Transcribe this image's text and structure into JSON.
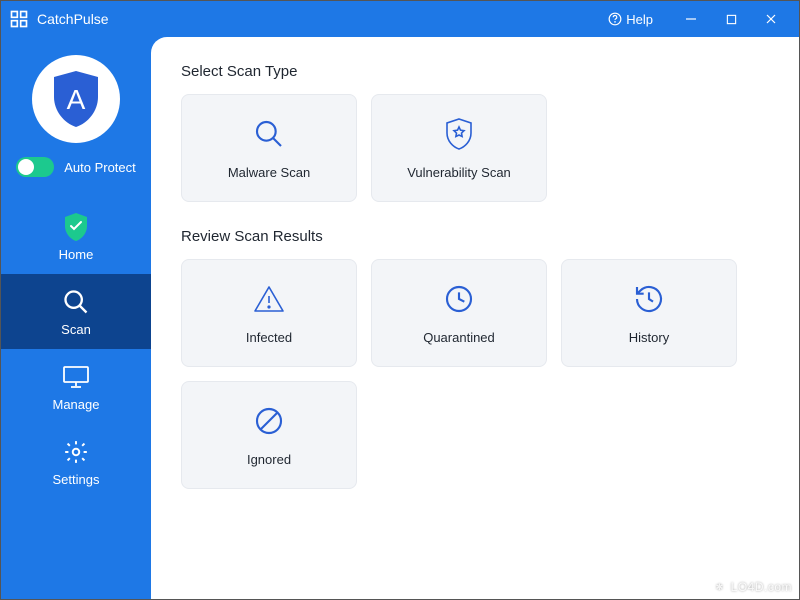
{
  "app": {
    "title": "CatchPulse",
    "help_label": "Help"
  },
  "sidebar": {
    "auto_protect_label": "Auto Protect",
    "auto_protect_on": true,
    "nav": [
      {
        "label": "Home",
        "icon": "shield-check-icon",
        "active": false
      },
      {
        "label": "Scan",
        "icon": "search-icon",
        "active": true
      },
      {
        "label": "Manage",
        "icon": "monitor-icon",
        "active": false
      },
      {
        "label": "Settings",
        "icon": "gear-icon",
        "active": false
      }
    ]
  },
  "content": {
    "section1_title": "Select Scan Type",
    "scan_types": [
      {
        "label": "Malware Scan",
        "icon": "search-icon"
      },
      {
        "label": "Vulnerability Scan",
        "icon": "shield-star-icon"
      }
    ],
    "section2_title": "Review Scan Results",
    "results": [
      {
        "label": "Infected",
        "icon": "warning-icon"
      },
      {
        "label": "Quarantined",
        "icon": "clock-icon"
      },
      {
        "label": "History",
        "icon": "history-icon"
      },
      {
        "label": "Ignored",
        "icon": "prohibit-icon"
      }
    ]
  },
  "watermark": "LO4D.com"
}
